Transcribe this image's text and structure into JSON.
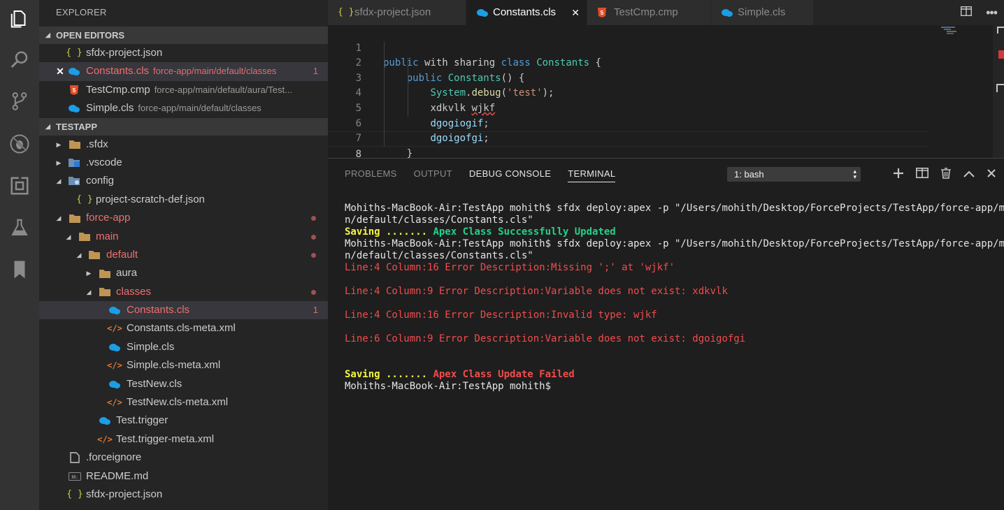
{
  "activity_bar": {
    "items": [
      "explorer-icon",
      "search-icon",
      "source-control-icon",
      "debug-icon",
      "extensions-icon",
      "test-flask-icon",
      "bookmark-icon"
    ]
  },
  "sidebar": {
    "title": "EXPLORER",
    "open_editors": {
      "header": "OPEN EDITORS",
      "items": [
        {
          "name": "sfdx-project.json",
          "path": "",
          "badge": ""
        },
        {
          "name": "Constants.cls",
          "path": "force-app/main/default/classes",
          "badge": "1"
        },
        {
          "name": "TestCmp.cmp",
          "path": "force-app/main/default/aura/Test...",
          "badge": ""
        },
        {
          "name": "Simple.cls",
          "path": "force-app/main/default/classes",
          "badge": ""
        }
      ]
    },
    "project": {
      "header": "TESTAPP",
      "items": [
        {
          "name": ".sfdx"
        },
        {
          "name": ".vscode"
        },
        {
          "name": "config"
        },
        {
          "name": "project-scratch-def.json"
        },
        {
          "name": "force-app"
        },
        {
          "name": "main"
        },
        {
          "name": "default"
        },
        {
          "name": "aura"
        },
        {
          "name": "classes"
        },
        {
          "name": "Constants.cls",
          "badge": "1"
        },
        {
          "name": "Constants.cls-meta.xml"
        },
        {
          "name": "Simple.cls"
        },
        {
          "name": "Simple.cls-meta.xml"
        },
        {
          "name": "TestNew.cls"
        },
        {
          "name": "TestNew.cls-meta.xml"
        },
        {
          "name": "Test.trigger"
        },
        {
          "name": "Test.trigger-meta.xml"
        },
        {
          "name": ".forceignore"
        },
        {
          "name": "README.md"
        },
        {
          "name": "sfdx-project.json"
        }
      ]
    }
  },
  "tabs": [
    {
      "label": "sfdx-project.json"
    },
    {
      "label": "Constants.cls"
    },
    {
      "label": "TestCmp.cmp"
    },
    {
      "label": "Simple.cls"
    }
  ],
  "editor": {
    "line_numbers": [
      "1",
      "2",
      "3",
      "4",
      "5",
      "6",
      "7",
      "8"
    ],
    "lines": {
      "l1": {
        "a": "public",
        "b": " with sharing ",
        "c": "class",
        "d": " ",
        "e": "Constants",
        "f": " {"
      },
      "l2": {
        "a": "    ",
        "b": "public",
        "c": " ",
        "d": "Constants",
        "e": "() {"
      },
      "l3": {
        "a": "        ",
        "b": "System",
        "c": ".",
        "d": "debug",
        "e": "(",
        "f": "'test'",
        "g": ");"
      },
      "l4": {
        "a": "        ",
        "b": "xdkvlk",
        "c": " ",
        "d": "wjkf"
      },
      "l5": {
        "a": "        ",
        "b": "dgogiogif",
        "c": ";"
      },
      "l6": {
        "a": "        ",
        "b": "dgoigofgi",
        "c": ";"
      },
      "l7": {
        "a": "    }"
      },
      "l8": {
        "a": "}"
      }
    }
  },
  "panel": {
    "tabs": [
      "PROBLEMS",
      "OUTPUT",
      "DEBUG CONSOLE",
      "TERMINAL"
    ],
    "terminal_select": "1: bash",
    "terminal": {
      "l1": "Mohiths-MacBook-Air:TestApp mohith$ sfdx deploy:apex -p \"/Users/mohith/Desktop/ForceProjects/TestApp/force-app/mai",
      "l2": "n/default/classes/Constants.cls\"",
      "l3a": "Saving .......",
      "l3b": " Apex Class Successfully Updated",
      "l4": "Mohiths-MacBook-Air:TestApp mohith$ sfdx deploy:apex -p \"/Users/mohith/Desktop/ForceProjects/TestApp/force-app/mai",
      "l5": "n/default/classes/Constants.cls\"",
      "e1": "Line:4 Column:16 Error Description:Missing ';' at 'wjkf'",
      "e2": "Line:4 Column:9 Error Description:Variable does not exist: xdkvlk",
      "e3": "Line:4 Column:16 Error Description:Invalid type: wjkf",
      "e4": "Line:6 Column:9 Error Description:Variable does not exist: dgoigofgi",
      "f1a": "Saving .......",
      "f1b": " Apex Class Update Failed",
      "prompt": "Mohiths-MacBook-Air:TestApp mohith$"
    }
  },
  "colors": {
    "activity_bar": "#333333",
    "sidebar": "#252526",
    "editor": "#1e1e1e",
    "error": "#f14c4c",
    "success": "#23d18b",
    "warn": "#f5f543"
  }
}
